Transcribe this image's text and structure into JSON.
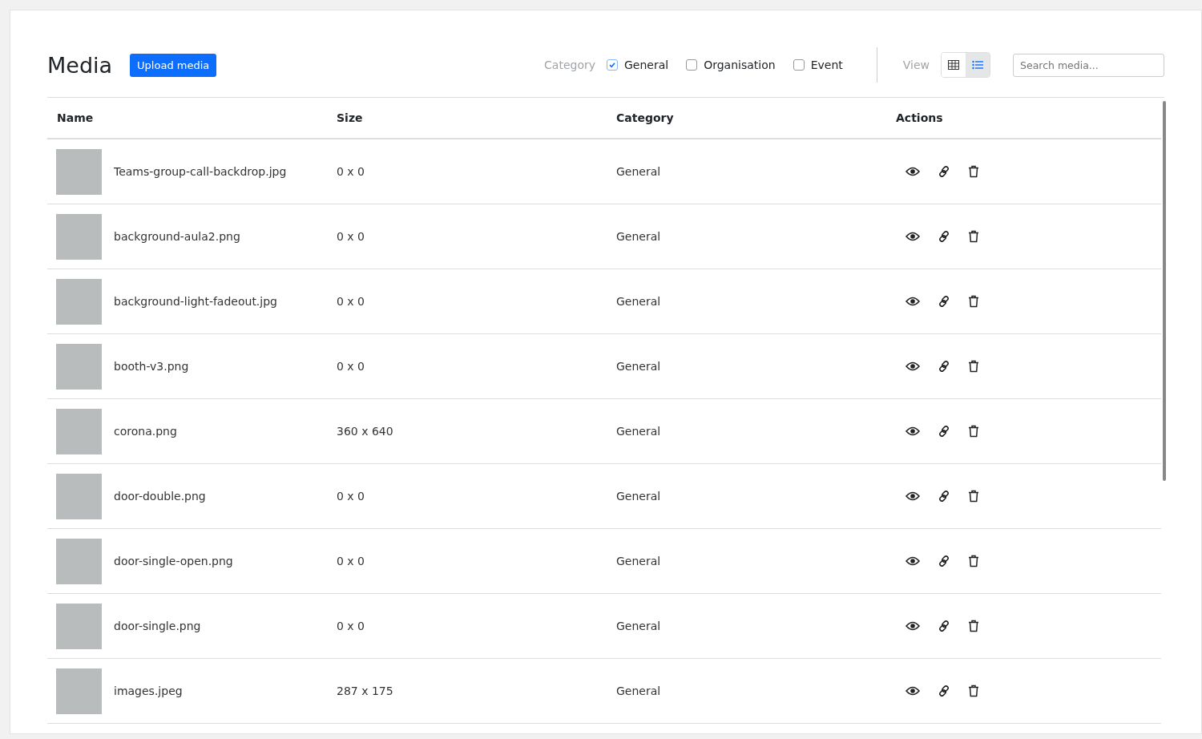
{
  "title": "Media",
  "upload_button": "Upload media",
  "category_label": "Category",
  "categories": [
    {
      "label": "General",
      "checked": true
    },
    {
      "label": "Organisation",
      "checked": false
    },
    {
      "label": "Event",
      "checked": false
    }
  ],
  "view_label": "View",
  "views": [
    {
      "kind": "grid",
      "selected": false
    },
    {
      "kind": "list",
      "selected": true
    }
  ],
  "search": {
    "placeholder": "Search media..."
  },
  "table": {
    "columns": [
      "Name",
      "Size",
      "Category",
      "Actions"
    ],
    "rows": [
      {
        "name": "Teams-group-call-backdrop.jpg",
        "size": "0 x 0",
        "category": "General"
      },
      {
        "name": "background-aula2.png",
        "size": "0 x 0",
        "category": "General"
      },
      {
        "name": "background-light-fadeout.jpg",
        "size": "0 x 0",
        "category": "General"
      },
      {
        "name": "booth-v3.png",
        "size": "0 x 0",
        "category": "General"
      },
      {
        "name": "corona.png",
        "size": "360 x 640",
        "category": "General"
      },
      {
        "name": "door-double.png",
        "size": "0 x 0",
        "category": "General"
      },
      {
        "name": "door-single-open.png",
        "size": "0 x 0",
        "category": "General"
      },
      {
        "name": "door-single.png",
        "size": "0 x 0",
        "category": "General"
      },
      {
        "name": "images.jpeg",
        "size": "287 x 175",
        "category": "General"
      }
    ]
  }
}
